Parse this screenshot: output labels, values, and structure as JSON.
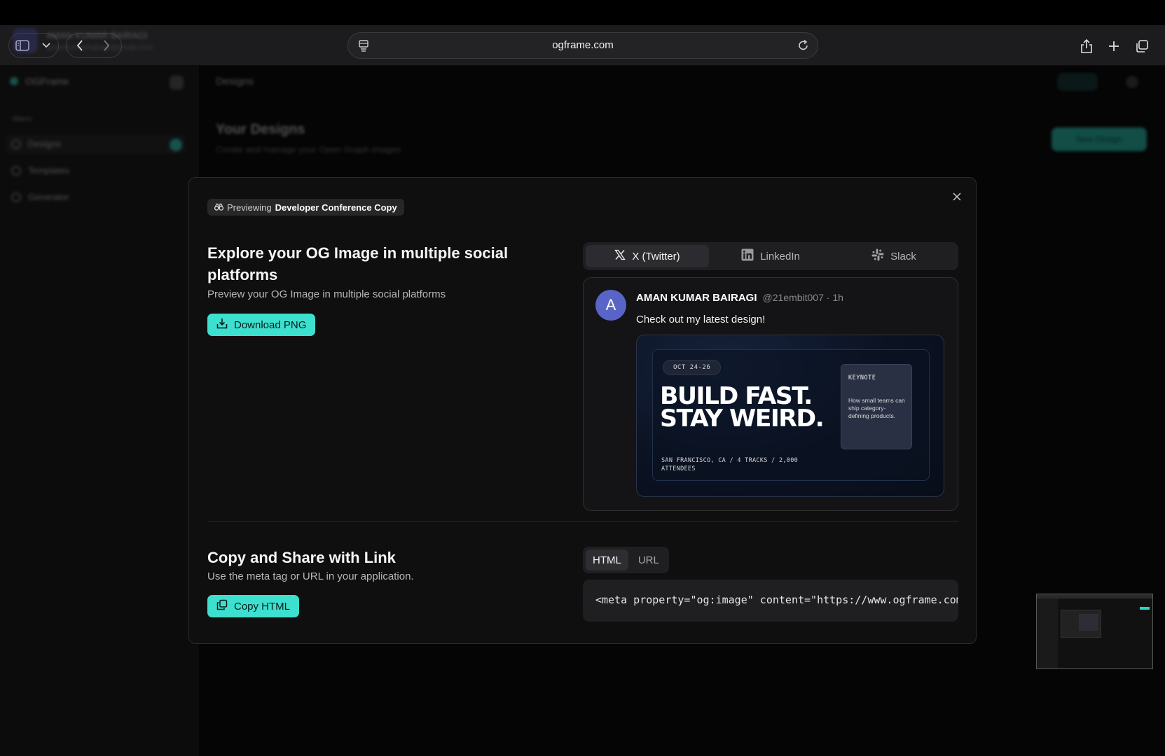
{
  "browser": {
    "url": "ogframe.com",
    "icons": [
      "sidebar-icon",
      "chevron-down-icon",
      "back-icon",
      "forward-icon",
      "page-icon",
      "reload-icon",
      "share-icon",
      "plus-icon",
      "tabs-icon"
    ]
  },
  "background_app": {
    "brand": "OGFrame",
    "menu_label": "Menu",
    "nav": [
      "Designs",
      "Templates",
      "Generator"
    ],
    "breadcrumb": "Designs",
    "page_title": "Your Designs",
    "page_subtitle": "Create and manage your Open Graph images",
    "new_button": "New Design",
    "user_name": "AMAN KUMAR BAIRAGI",
    "user_email": "amankumarbairagi@gmail.com"
  },
  "modal": {
    "preview_chip": {
      "prefix": "Previewing",
      "name": "Developer Conference Copy"
    },
    "explore": {
      "title": "Explore your OG Image in multiple social platforms",
      "subtitle": "Preview your OG Image in multiple social platforms",
      "download_label": "Download PNG"
    },
    "platform_tabs": [
      {
        "label": "X (Twitter)",
        "icon": "x-logo-icon",
        "active": true
      },
      {
        "label": "LinkedIn",
        "icon": "linkedin-icon",
        "active": false
      },
      {
        "label": "Slack",
        "icon": "slack-icon",
        "active": false
      }
    ],
    "tweet": {
      "avatar_letter": "A",
      "name": "AMAN KUMAR BAIRAGI",
      "handle": "@21embit007 · 1h",
      "text": "Check out my latest design!"
    },
    "og_image": {
      "date": "OCT 24-26",
      "headline_1": "BUILD FAST.",
      "headline_2": "STAY WEIRD.",
      "footer": "SAN FRANCISCO, CA / 4 TRACKS / 2,000 ATTENDEES",
      "keynote_label": "KEYNOTE",
      "keynote_text": "How small teams can ship category-defining products."
    },
    "share": {
      "title": "Copy and Share with Link",
      "subtitle": "Use the meta tag or URL in your application.",
      "copy_label": "Copy HTML",
      "code_tabs": [
        {
          "label": "HTML",
          "active": true
        },
        {
          "label": "URL",
          "active": false
        }
      ],
      "code": "<meta property=\"og:image\" content=\"https://www.ogframe.com/api/og?id=developer-conference-copy\" />"
    }
  },
  "colors": {
    "accent": "#3de0cf",
    "modal_bg": "#0f0f10",
    "avatar": "#5865c7"
  }
}
